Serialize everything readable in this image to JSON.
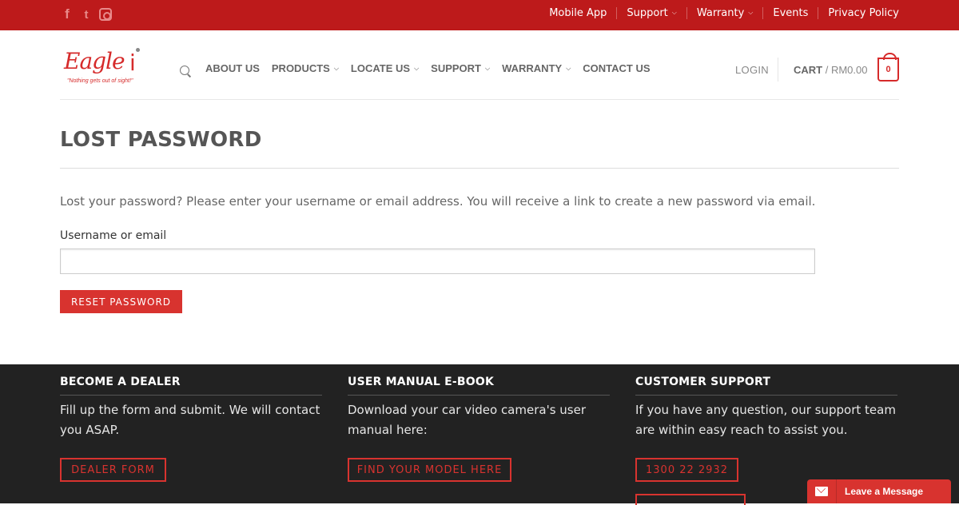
{
  "topbar": {
    "social": [
      "facebook-icon",
      "twitter-icon",
      "instagram-icon"
    ],
    "nav": [
      {
        "label": "Mobile App",
        "dropdown": false
      },
      {
        "label": "Support",
        "dropdown": true
      },
      {
        "label": "Warranty",
        "dropdown": true
      },
      {
        "label": "Events",
        "dropdown": false
      },
      {
        "label": "Privacy Policy",
        "dropdown": false
      }
    ]
  },
  "header": {
    "logo": {
      "word": "Eagle",
      "mark": "i",
      "tagline": "\"Nothing gets out of sight!\""
    },
    "nav": [
      {
        "label": "ABOUT US",
        "dropdown": false
      },
      {
        "label": "PRODUCTS",
        "dropdown": true
      },
      {
        "label": "LOCATE US",
        "dropdown": true
      },
      {
        "label": "SUPPORT",
        "dropdown": true
      },
      {
        "label": "WARRANTY",
        "dropdown": true
      },
      {
        "label": "CONTACT US",
        "dropdown": false
      }
    ],
    "login": "LOGIN",
    "cart_label": "CART",
    "cart_sep": " / ",
    "cart_amount": "RM0.00",
    "cart_count": "0"
  },
  "main": {
    "title": "LOST PASSWORD",
    "intro": "Lost your password? Please enter your username or email address. You will receive a link to create a new password via email.",
    "field_label": "Username or email",
    "field_value": "",
    "button": "RESET PASSWORD"
  },
  "footer": {
    "columns": [
      {
        "title": "BECOME A DEALER",
        "text": "Fill up the form and submit. We will contact you ASAP.",
        "button": "DEALER FORM"
      },
      {
        "title": "USER MANUAL E-BOOK",
        "text": "Download your car video camera's user manual here:",
        "button": "FIND YOUR MODEL HERE"
      },
      {
        "title": "CUSTOMER SUPPORT",
        "text": "If you have any question, our support team are within easy reach to assist you.",
        "button": "1300 22 2932"
      }
    ]
  },
  "chat": {
    "label": "Leave a Message"
  },
  "colors": {
    "brand_red": "#bd1a1b",
    "accent_red": "#d8332f",
    "footer_bg": "#222222"
  }
}
